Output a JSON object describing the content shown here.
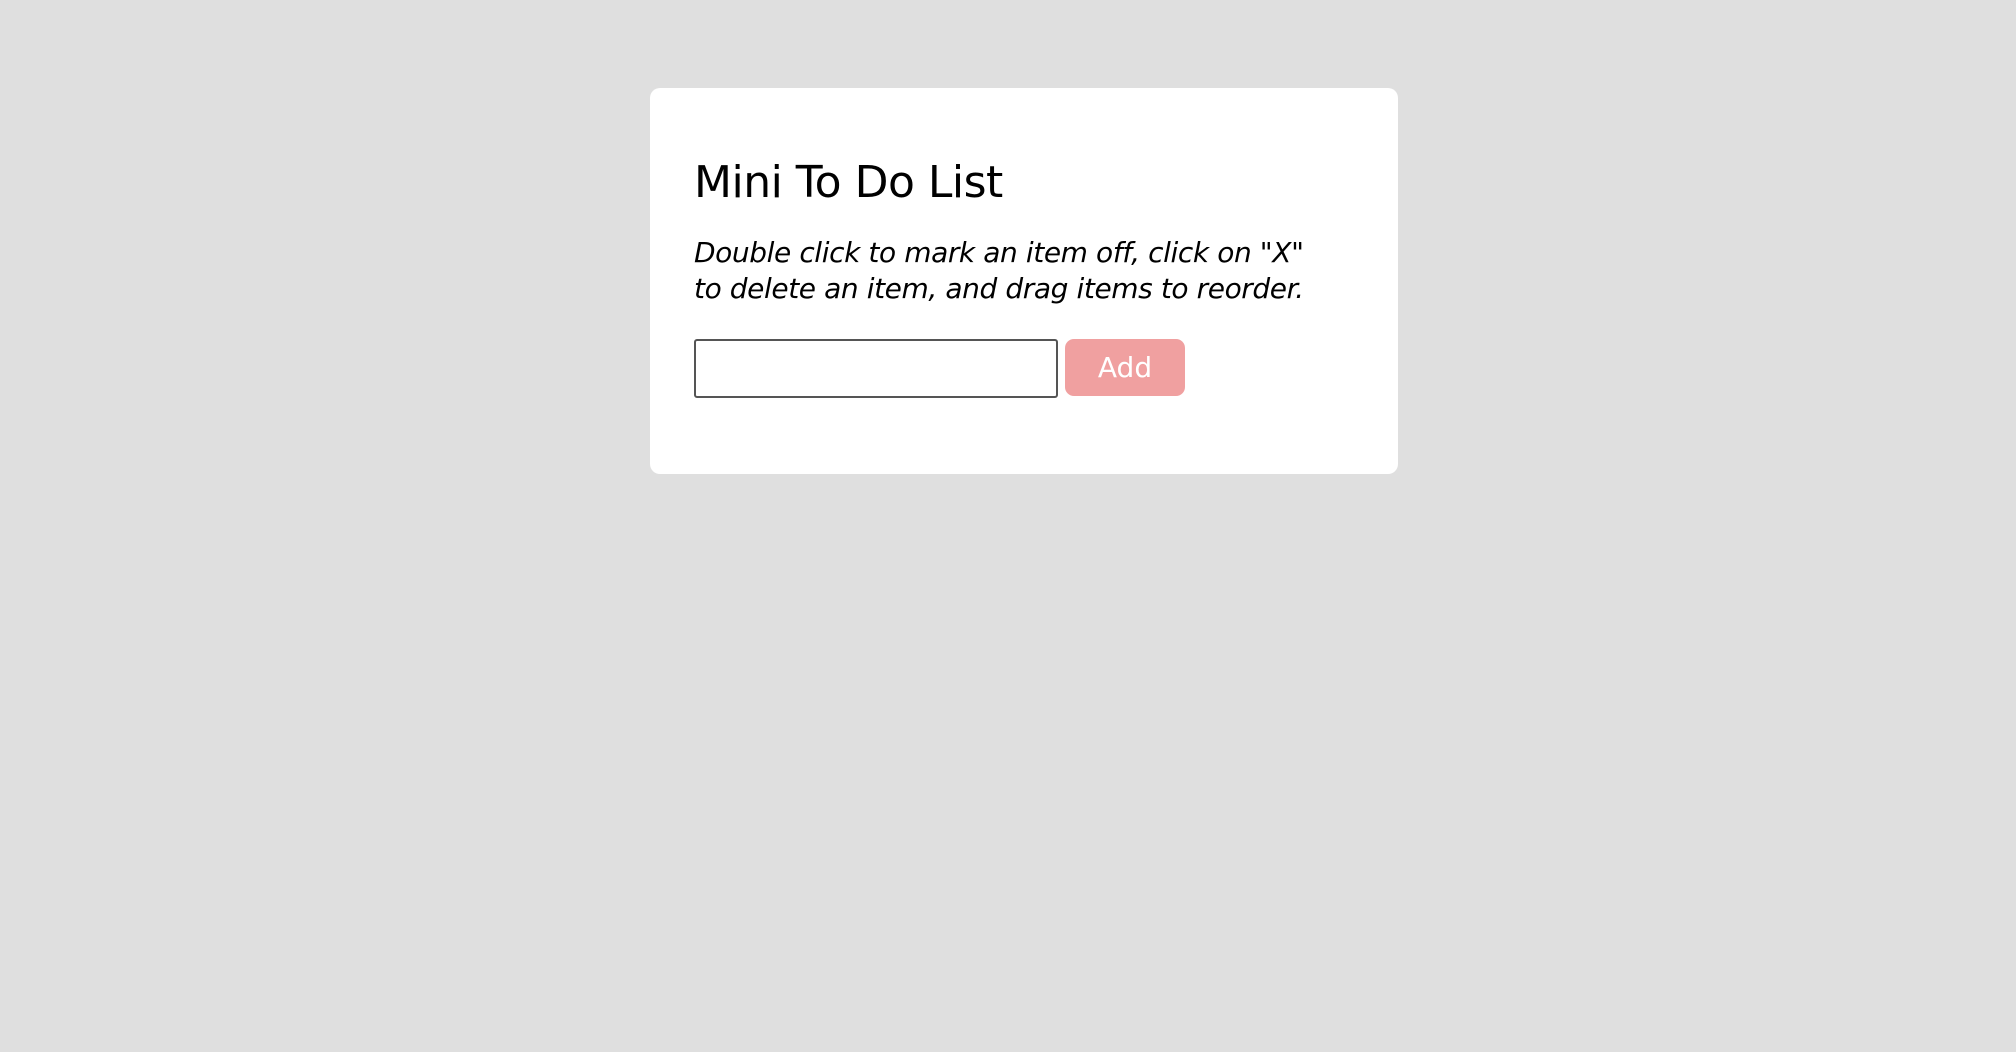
{
  "app": {
    "title": "Mini To Do List",
    "instructions": "Double click to mark an item off, click on \"X\" to delete an item, and drag items to reorder."
  },
  "form": {
    "input_value": "",
    "input_placeholder": "",
    "add_label": "Add"
  },
  "colors": {
    "page_background": "#dfdfdf",
    "card_background": "#ffffff",
    "add_button": "#f0a0a0"
  }
}
